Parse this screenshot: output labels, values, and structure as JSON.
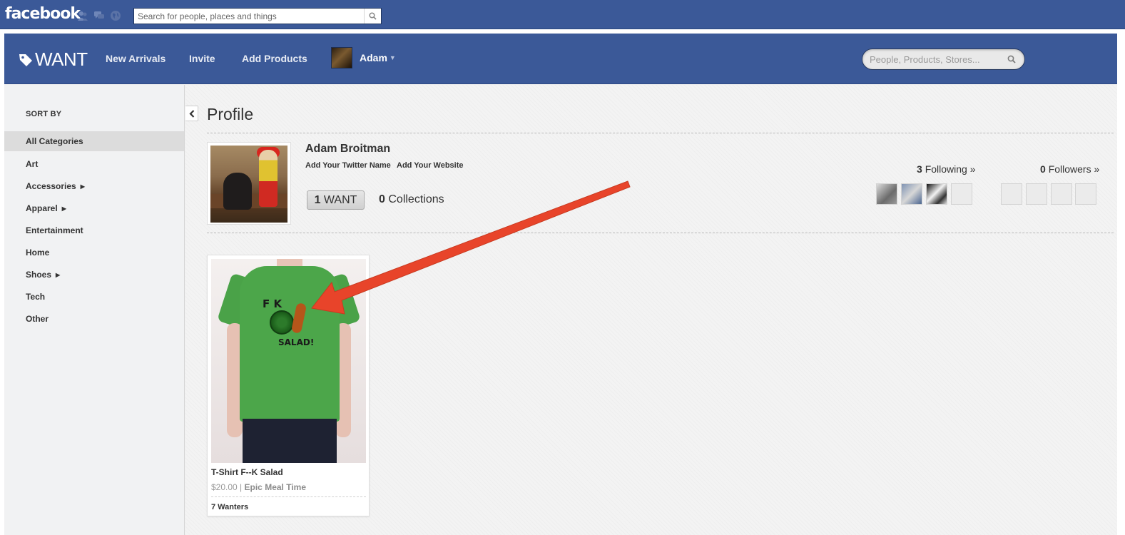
{
  "facebook": {
    "logo": "facebook",
    "search_placeholder": "Search for people, places and things",
    "jewels": [
      "friend-requests-icon",
      "messages-icon",
      "notifications-globe-icon"
    ]
  },
  "app": {
    "logo_text": "WANT",
    "nav": [
      "New Arrivals",
      "Invite",
      "Add Products"
    ],
    "user_name": "Adam",
    "search_placeholder": "People, Products, Stores..."
  },
  "sidebar": {
    "heading": "SORT BY",
    "items": [
      {
        "label": "All Categories",
        "has_submenu": false,
        "active": true
      },
      {
        "label": "Art",
        "has_submenu": false
      },
      {
        "label": "Accessories",
        "has_submenu": true
      },
      {
        "label": "Apparel",
        "has_submenu": true
      },
      {
        "label": "Entertainment",
        "has_submenu": false
      },
      {
        "label": "Home",
        "has_submenu": false
      },
      {
        "label": "Shoes",
        "has_submenu": true
      },
      {
        "label": "Tech",
        "has_submenu": false
      },
      {
        "label": "Other",
        "has_submenu": false
      }
    ]
  },
  "profile": {
    "page_title": "Profile",
    "name": "Adam Broitman",
    "twitter_link": "Add Your Twitter Name",
    "website_link": "Add Your Website",
    "want_count": "1",
    "want_label": "WANT",
    "collections_count": "0",
    "collections_label": "Collections",
    "following_count": "3",
    "following_label": "Following »",
    "followers_count": "0",
    "followers_label": "Followers »"
  },
  "product": {
    "title": "T-Shirt F--K Salad",
    "price": "$20.00",
    "separator": "|",
    "store": "Epic Meal Time",
    "wanters": "7 Wanters",
    "print_line1": "F  K",
    "print_line2": "SALAD!"
  },
  "colors": {
    "facebook_blue": "#3b5998",
    "annotation_arrow": "#e8442a"
  }
}
